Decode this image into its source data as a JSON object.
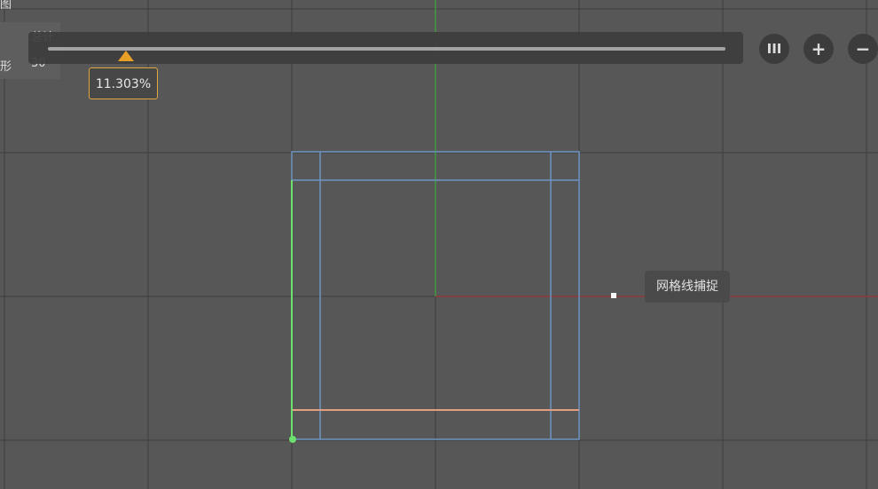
{
  "left_panel": {
    "label_top": "总计",
    "label_left": "形",
    "value": "30",
    "corner": "图"
  },
  "zoom_slider": {
    "percent_label": "11.303%",
    "value_percent": 11.303
  },
  "controls": [
    {
      "name": "pause",
      "glyph": "III"
    },
    {
      "name": "zoom-in",
      "glyph": "+"
    },
    {
      "name": "zoom-out",
      "glyph": "−"
    }
  ],
  "snap_tooltip": "网格线捕捉",
  "colors": {
    "background": "#575757",
    "grid": "#3f3f3f",
    "shape": "#6e93c2",
    "y_axis": "#3bbf3b",
    "x_axis": "#b53030",
    "highlight_edge": "#e0a080",
    "selected_edge": "#6ee06e",
    "accent": "#f5a623"
  }
}
